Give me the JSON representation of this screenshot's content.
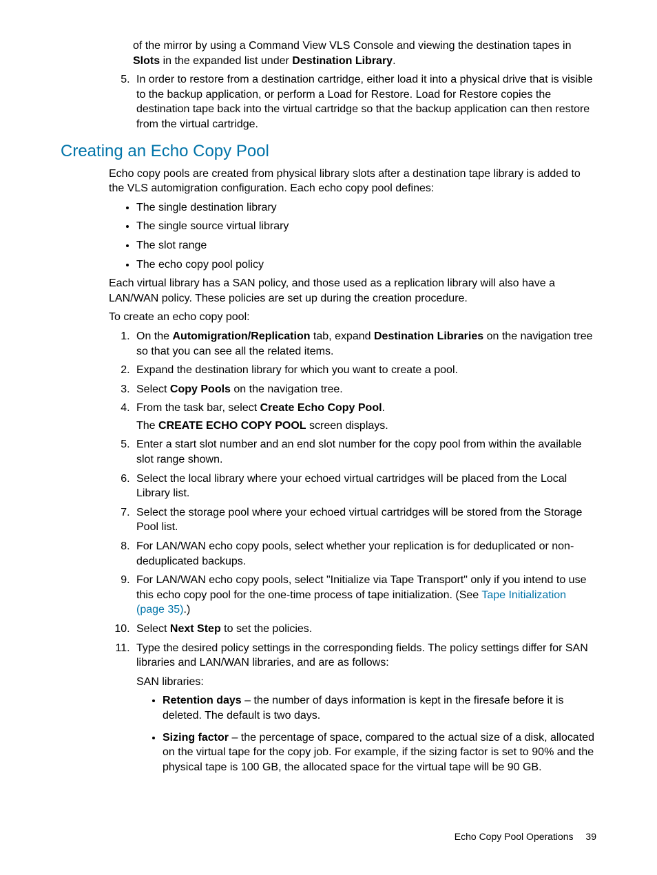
{
  "continuation": {
    "para1_a": "of the mirror by using a Command View VLS Console and viewing the destination tapes in ",
    "para1_b": "Slots",
    "para1_c": " in the expanded list under ",
    "para1_d": "Destination Library",
    "para1_e": ".",
    "step5": "In order to restore from a destination cartridge, either load it into a physical drive that is visible to the backup application, or perform a Load for Restore. Load for Restore copies the destination tape back into the virtual cartridge so that the backup application can then restore from the virtual cartridge."
  },
  "heading": "Creating an Echo Copy Pool",
  "intro1": "Echo copy pools are created from physical library slots after a destination tape library is added to the VLS automigration configuration. Each echo copy pool defines:",
  "bullets": [
    "The single destination library",
    "The single source virtual library",
    "The slot range",
    "The echo copy pool policy"
  ],
  "intro2": "Each virtual library has a SAN policy, and those used as a replication library will also have a LAN/WAN policy. These policies are set up during the creation procedure.",
  "intro3": "To create an echo copy pool:",
  "steps": {
    "s1_a": "On the ",
    "s1_b": "Automigration/Replication",
    "s1_c": " tab, expand ",
    "s1_d": "Destination Libraries",
    "s1_e": " on the navigation tree so that you can see all the related items.",
    "s2": "Expand the destination library for which you want to create a pool.",
    "s3_a": "Select ",
    "s3_b": "Copy Pools",
    "s3_c": " on the navigation tree.",
    "s4_a": "From the task bar, select ",
    "s4_b": "Create Echo Copy Pool",
    "s4_c": ".",
    "s4_sub_a": "The ",
    "s4_sub_b": "CREATE ECHO COPY POOL",
    "s4_sub_c": " screen displays.",
    "s5": "Enter a start slot number and an end slot number for the copy pool from within the available slot range shown.",
    "s6": "Select the local library where your echoed virtual cartridges will be placed from the Local Library list.",
    "s7": "Select the storage pool where your echoed virtual cartridges will be stored from the Storage Pool list.",
    "s8": "For LAN/WAN echo copy pools, select whether your replication is for deduplicated or non-deduplicated backups.",
    "s9_a": "For LAN/WAN echo copy pools, select \"Initialize via Tape Transport\" only if you intend to use this echo copy pool for the one-time process of tape initialization. (See ",
    "s9_link": "Tape Initialization (page 35)",
    "s9_b": ".)",
    "s10_a": "Select ",
    "s10_b": "Next Step",
    "s10_c": " to set the policies.",
    "s11": "Type the desired policy settings in the corresponding fields. The policy settings differ for SAN libraries and LAN/WAN libraries, and are as follows:",
    "s11_sub": "SAN libraries:",
    "s11_b1_a": "Retention days",
    "s11_b1_b": " – the number of days information is kept in the firesafe before it is deleted. The default is two days.",
    "s11_b2_a": "Sizing factor",
    "s11_b2_b": " – the percentage of space, compared to the actual size of a disk, allocated on the virtual tape for the copy job. For example, if the sizing factor is set to 90% and the physical tape is 100 GB, the allocated space for the virtual tape will be 90 GB."
  },
  "footer": {
    "title": "Echo Copy Pool Operations",
    "page": "39"
  }
}
